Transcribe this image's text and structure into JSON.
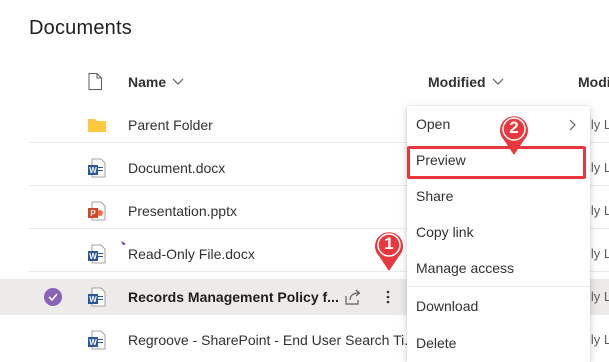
{
  "page": {
    "title": "Documents"
  },
  "columns": {
    "name": "Name",
    "modified": "Modified",
    "modified_by": "Modi"
  },
  "files": [
    {
      "name": "Parent Folder",
      "type": "folder-icon",
      "modified_by": "lly L"
    },
    {
      "name": "Document.docx",
      "type": "word-icon",
      "modified_by": "lly L"
    },
    {
      "name": "Presentation.pptx",
      "type": "powerpoint-icon",
      "modified_by": "lly L"
    },
    {
      "name": "Read-Only File.docx",
      "type": "word-icon",
      "modified_by": "lly L"
    },
    {
      "name": "Records Management Policy f...",
      "type": "word-icon",
      "modified_by": "lly L",
      "selected": true
    },
    {
      "name": "Regroove - SharePoint - End User Search Ti...",
      "type": "word-icon",
      "modified_by": "lly L"
    }
  ],
  "context_menu": {
    "items": [
      {
        "label": "Open",
        "has_submenu": true
      },
      {
        "label": "Preview"
      },
      {
        "label": "Share"
      },
      {
        "label": "Copy link"
      },
      {
        "label": "Manage access"
      },
      {
        "label": "Download"
      },
      {
        "label": "Delete"
      }
    ]
  },
  "annotations": {
    "step1": "1",
    "step2": "2"
  },
  "colors": {
    "accent": "#8764b8",
    "highlight": "#e8383d",
    "folder": "#ffb900",
    "word": "#2b579a",
    "powerpoint": "#d24726"
  }
}
